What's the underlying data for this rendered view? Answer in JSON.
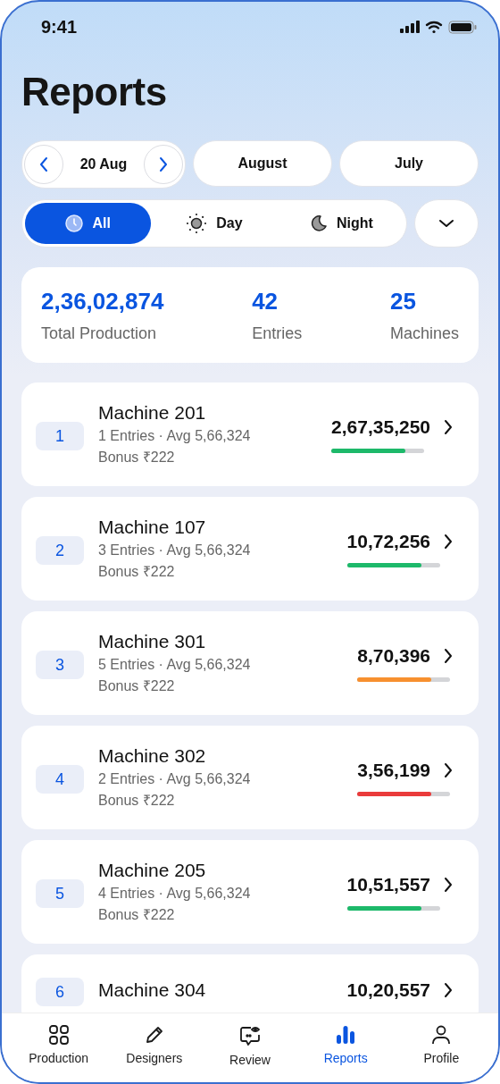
{
  "status_bar": {
    "time": "9:41"
  },
  "title": "Reports",
  "date_picker": {
    "date": "20 Aug"
  },
  "periods": [
    {
      "label": "August",
      "selected": false
    },
    {
      "label": "July",
      "selected": false
    }
  ],
  "shifts": [
    {
      "label": "All",
      "kind": "all",
      "selected": true
    },
    {
      "label": "Day",
      "kind": "day",
      "selected": false
    },
    {
      "label": "Night",
      "kind": "night",
      "selected": false
    }
  ],
  "summary": [
    {
      "value": "2,36,02,874",
      "label": "Total Production"
    },
    {
      "value": "42",
      "label": "Entries"
    },
    {
      "value": "25",
      "label": "Machines"
    }
  ],
  "machines": [
    {
      "rank": "1",
      "name": "Machine 201",
      "details": "1 Entries · Avg 5,66,324",
      "bonus": "Bonus ₹222",
      "total": "2,67,35,250",
      "level": 0.8,
      "color": "#1db96a"
    },
    {
      "rank": "2",
      "name": "Machine 107",
      "details": "3 Entries · Avg 5,66,324",
      "bonus": "Bonus ₹222",
      "total": "10,72,256",
      "level": 0.8,
      "color": "#1db96a"
    },
    {
      "rank": "3",
      "name": "Machine 301",
      "details": "5 Entries · Avg 5,66,324",
      "bonus": "Bonus ₹222",
      "total": "8,70,396",
      "level": 0.8,
      "color": "#f7902f"
    },
    {
      "rank": "4",
      "name": "Machine 302",
      "details": "2 Entries · Avg 5,66,324",
      "bonus": "Bonus ₹222",
      "total": "3,56,199",
      "level": 0.8,
      "color": "#ea3b3b"
    },
    {
      "rank": "5",
      "name": "Machine 205",
      "details": "4 Entries · Avg 5,66,324",
      "bonus": "Bonus ₹222",
      "total": "10,51,557",
      "level": 0.8,
      "color": "#1db96a"
    },
    {
      "rank": "6",
      "name": "Machine 304",
      "total": "10,20,557"
    }
  ],
  "tab_bar": [
    {
      "label": "Production",
      "kind": "grid",
      "selected": false
    },
    {
      "label": "Designers",
      "kind": "pencil",
      "selected": false
    },
    {
      "label": "Review",
      "kind": "review",
      "selected": false
    },
    {
      "label": "Reports",
      "kind": "chart",
      "selected": true
    },
    {
      "label": "Profile",
      "kind": "person",
      "selected": false
    }
  ]
}
